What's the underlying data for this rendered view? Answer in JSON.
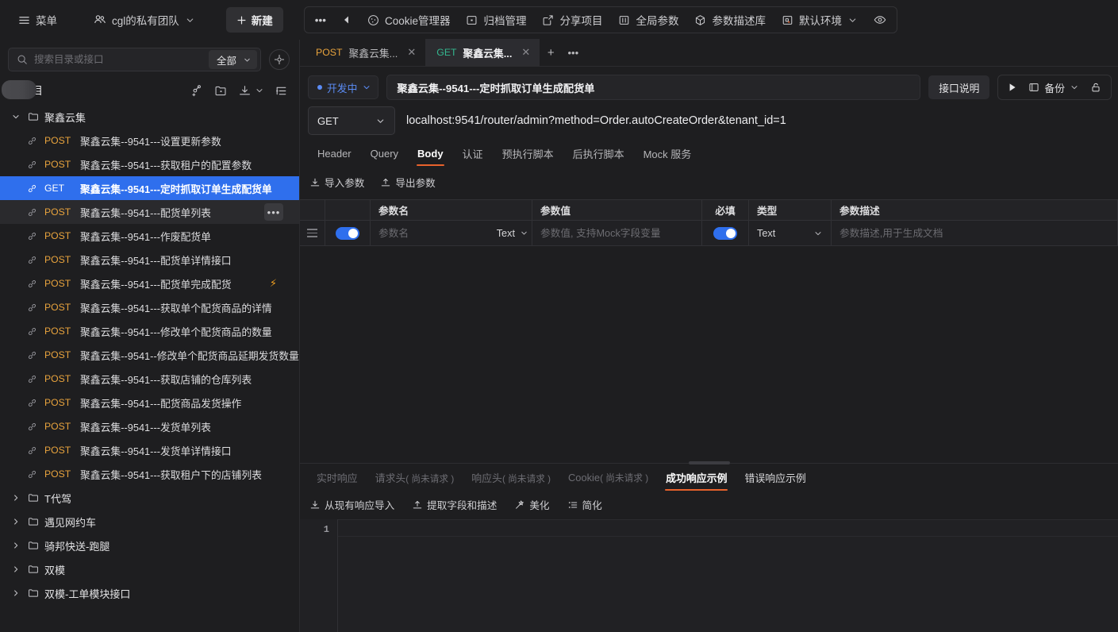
{
  "topbar": {
    "menu_label": "菜单",
    "team_label": "cgl的私有团队",
    "new_label": "新建",
    "more_label": "•••",
    "items": [
      {
        "label": "Cookie管理器",
        "icon": "cookie-icon"
      },
      {
        "label": "归档管理",
        "icon": "archive-icon"
      },
      {
        "label": "分享项目",
        "icon": "share-icon"
      },
      {
        "label": "全局参数",
        "icon": "global-params-icon"
      },
      {
        "label": "参数描述库",
        "icon": "param-library-icon"
      },
      {
        "label": "默认环境",
        "icon": "environment-icon"
      }
    ]
  },
  "sidebar": {
    "search_placeholder": "搜索目录或接口",
    "search_value": "",
    "filter_label": "全部",
    "project_name": "司项目",
    "tree": [
      {
        "type": "folder",
        "label": "聚鑫云集",
        "expanded": true,
        "children": [
          {
            "method": "POST",
            "label": "聚鑫云集--9541---设置更新参数"
          },
          {
            "method": "POST",
            "label": "聚鑫云集--9541---获取租户的配置参数"
          },
          {
            "method": "GET",
            "label": "聚鑫云集--9541---定时抓取订单生成配货单",
            "selected": true
          },
          {
            "method": "POST",
            "label": "聚鑫云集--9541---配货单列表",
            "hovered": true,
            "more": "•••"
          },
          {
            "method": "POST",
            "label": "聚鑫云集--9541---作废配货单"
          },
          {
            "method": "POST",
            "label": "聚鑫云集--9541---配货单详情接口"
          },
          {
            "method": "POST",
            "label": "聚鑫云集--9541---配货单完成配货",
            "bolt": true
          },
          {
            "method": "POST",
            "label": "聚鑫云集--9541---获取单个配货商品的详情"
          },
          {
            "method": "POST",
            "label": "聚鑫云集--9541---修改单个配货商品的数量"
          },
          {
            "method": "POST",
            "label": "聚鑫云集--9541--修改单个配货商品延期发货数量"
          },
          {
            "method": "POST",
            "label": "聚鑫云集--9541---获取店铺的仓库列表"
          },
          {
            "method": "POST",
            "label": "聚鑫云集--9541---配货商品发货操作"
          },
          {
            "method": "POST",
            "label": "聚鑫云集--9541---发货单列表"
          },
          {
            "method": "POST",
            "label": "聚鑫云集--9541---发货单详情接口"
          },
          {
            "method": "POST",
            "label": "聚鑫云集--9541---获取租户下的店铺列表"
          }
        ]
      },
      {
        "type": "folder",
        "label": "T代驾",
        "expanded": false
      },
      {
        "type": "folder",
        "label": "遇见网约车",
        "expanded": false
      },
      {
        "type": "folder",
        "label": "骑邦快送-跑腿",
        "expanded": false
      },
      {
        "type": "folder",
        "label": "双模",
        "expanded": false
      },
      {
        "type": "folder",
        "label": "双模-工单模块接口",
        "expanded": false
      }
    ]
  },
  "tabs": [
    {
      "method": "POST",
      "label": "聚鑫云集...",
      "active": false
    },
    {
      "method": "GET",
      "label": "聚鑫云集...",
      "active": true
    }
  ],
  "request": {
    "status_label": "开发中",
    "name_value": "聚鑫云集--9541---定时抓取订单生成配货单",
    "desc_button": "接口说明",
    "backup_label": "备份",
    "method": "GET",
    "url": "localhost:9541/router/admin?method=Order.autoCreateOrder&tenant_id=1",
    "sub_tabs": [
      {
        "label": "Header",
        "active": false
      },
      {
        "label": "Query",
        "active": false
      },
      {
        "label": "Body",
        "active": true
      },
      {
        "label": "认证",
        "active": false
      },
      {
        "label": "预执行脚本",
        "active": false
      },
      {
        "label": "后执行脚本",
        "active": false
      },
      {
        "label": "Mock 服务",
        "active": false
      }
    ],
    "actions": [
      {
        "label": "导入参数",
        "icon": "import-icon"
      },
      {
        "label": "导出参数",
        "icon": "export-icon"
      }
    ]
  },
  "param_table": {
    "headers": [
      "",
      "",
      "参数名",
      "参数值",
      "必填",
      "类型",
      "参数描述"
    ],
    "rows": [
      {
        "enabled": true,
        "name_placeholder": "参数名",
        "name_value": "",
        "name_type": "Text",
        "value_placeholder": "参数值, 支持Mock字段变量",
        "value_value": "",
        "required": true,
        "type": "Text",
        "desc_placeholder": "参数描述,用于生成文档",
        "desc_value": ""
      }
    ]
  },
  "response": {
    "tabs": [
      {
        "label": "实时响应",
        "suffix": "",
        "state": "dim"
      },
      {
        "label": "请求头",
        "suffix": "( 尚未请求 )",
        "state": "dim"
      },
      {
        "label": "响应头",
        "suffix": "( 尚未请求 )",
        "state": "dim"
      },
      {
        "label": "Cookie",
        "suffix": "( 尚未请求 )",
        "state": "dim"
      },
      {
        "label": "成功响应示例",
        "suffix": "",
        "state": "active"
      },
      {
        "label": "错误响应示例",
        "suffix": "",
        "state": "strong"
      }
    ],
    "actions": [
      {
        "label": "从现有响应导入",
        "icon": "import-icon"
      },
      {
        "label": "提取字段和描述",
        "icon": "extract-icon"
      },
      {
        "label": "美化",
        "icon": "beautify-icon"
      },
      {
        "label": "简化",
        "icon": "simplify-icon"
      }
    ],
    "line_number": "1",
    "code": ""
  },
  "colors": {
    "accent_blue": "#2f6fed",
    "accent_orange": "#e8622c",
    "method_post": "#e8a33d",
    "method_get": "#34b78f",
    "status_blue": "#5b8cf5",
    "bolt": "#f0a020"
  }
}
